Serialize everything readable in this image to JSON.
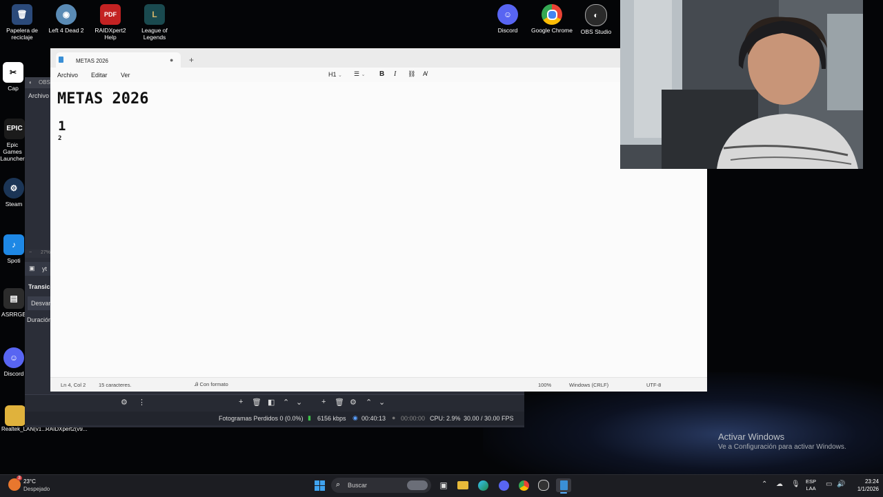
{
  "desktop": {
    "icons_top": [
      {
        "label": "Papelera de reciclaje",
        "glyph": "🗑",
        "color": "#2b4a7a"
      },
      {
        "label": "Left 4 Dead 2",
        "glyph": "◉",
        "color": "#5a8bb5"
      },
      {
        "label": "RAIDXpert2 Help",
        "glyph": "PDF",
        "color": "#c32222"
      },
      {
        "label": "League of Legends",
        "glyph": "L",
        "color": "#1a4a4f"
      },
      {
        "label": "Discord",
        "glyph": "☺",
        "color": "#5865f2"
      },
      {
        "label": "Google Chrome",
        "glyph": "◎",
        "color": "#34a853"
      },
      {
        "label": "OBS Studio",
        "glyph": "◐",
        "color": "#2a2a2a"
      }
    ],
    "icons_left": [
      {
        "label": "Cap"
      },
      {
        "label": "Epic Games Launcher"
      },
      {
        "label": "Steam"
      },
      {
        "label": "Spoti"
      },
      {
        "label": "ASRRGB"
      },
      {
        "label": "Discord"
      }
    ],
    "bottom_labels": [
      "Realtek_LAN(v1...",
      "RAIDXpert2(v9..."
    ],
    "watermark": {
      "title": "Activar Windows",
      "subtitle": "Ve a Configuración para activar Windows."
    }
  },
  "obs": {
    "title": "OBS",
    "menu_first": "Archivo",
    "zoom": "27%",
    "scene_item": "yt",
    "transitions_label": "Transicio",
    "transition_value": "Desvan",
    "duration_label": "Duración",
    "status": {
      "dropped": "Fotogramas Perdidos 0 (0.0%)",
      "bitrate": "6156 kbps",
      "stream_time": "00:40:13",
      "rec_time": "00:00:00",
      "cpu": "CPU: 2.9%",
      "fps": "30.00 / 30.00 FPS"
    }
  },
  "notepad": {
    "tab_title": "METAS 2026",
    "menus": [
      "Archivo",
      "Editar",
      "Ver"
    ],
    "toolbar": {
      "heading": "H1"
    },
    "content": {
      "h1": "METAS 2026",
      "h2": "1",
      "line3": "2"
    },
    "status": {
      "position": "Ln 4, Col 2",
      "chars": "15 caracteres.",
      "format": "Con formato",
      "zoom": "100%",
      "eol": "Windows (CRLF)",
      "encoding": "UTF-8"
    }
  },
  "taskbar": {
    "weather_temp": "23°C",
    "weather_desc": "Despejado",
    "weather_badge": "3",
    "search_placeholder": "Buscar",
    "lang_line1": "ESP",
    "lang_line2": "LAA",
    "time": "23:24",
    "date": "1/1/2026"
  }
}
